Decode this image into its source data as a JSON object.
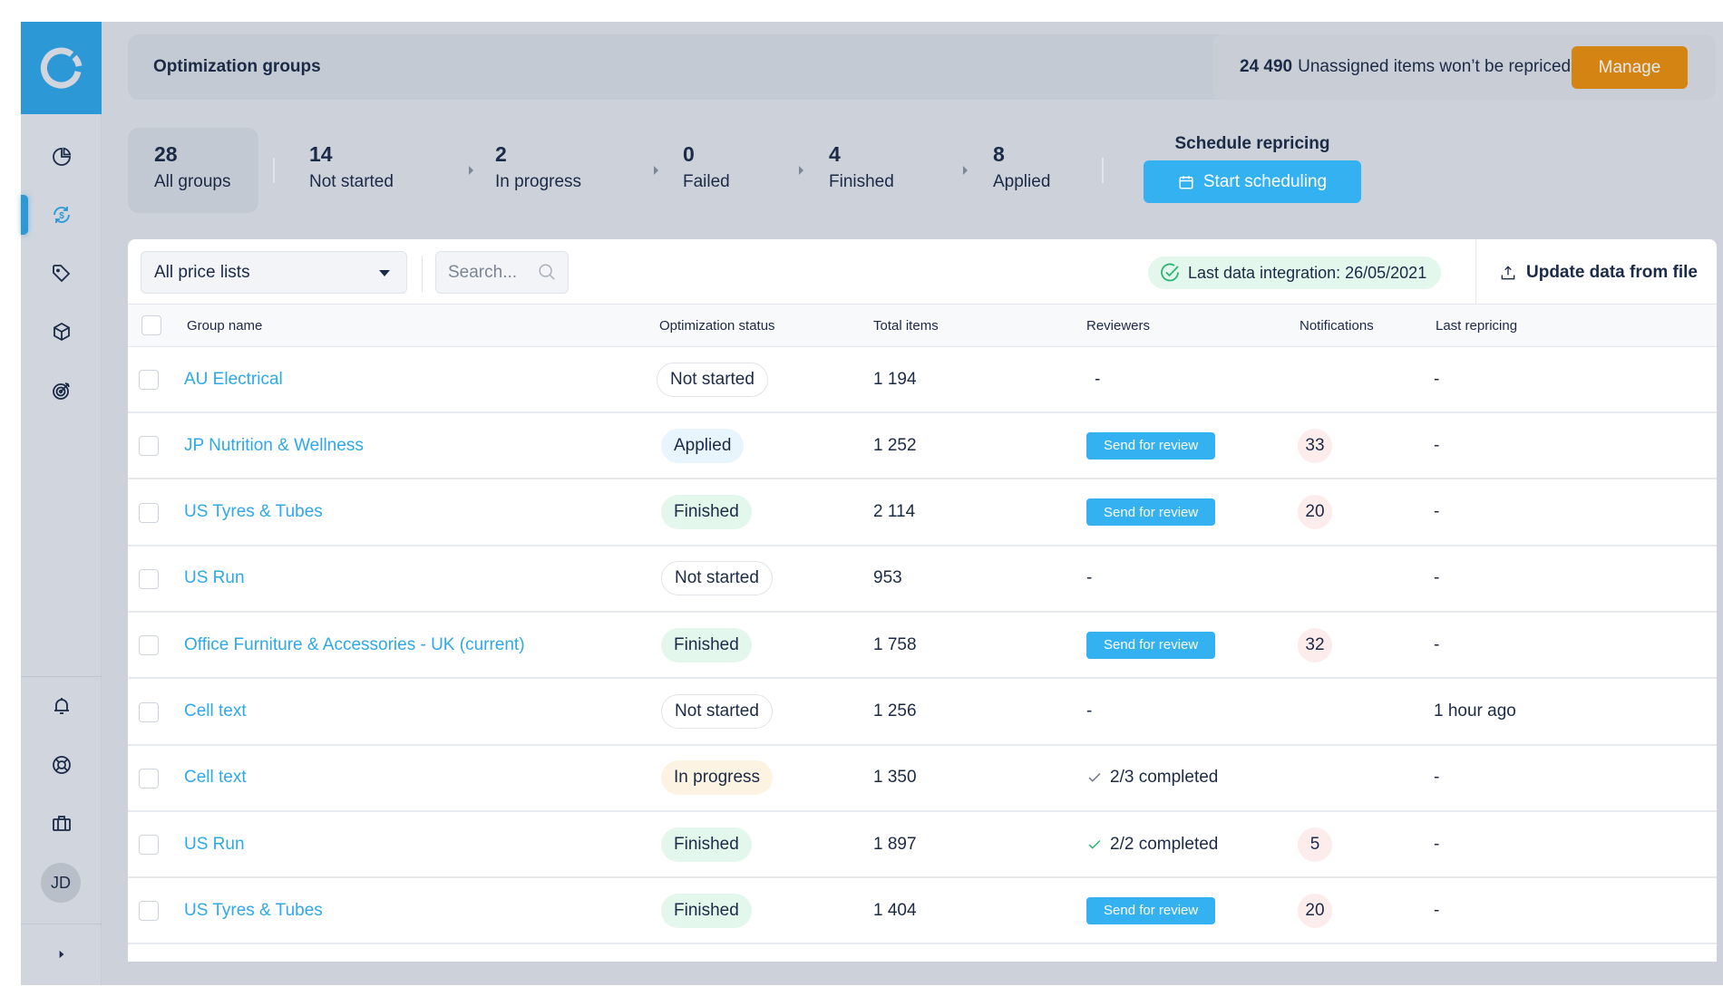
{
  "header": {
    "title": "Optimization groups",
    "unassigned_count": "24 490",
    "unassigned_text": "Unassigned items won’t be repriced",
    "manage_label": "Manage"
  },
  "sidebar": {
    "logo": "logo-icon",
    "items": [
      {
        "name": "dashboard",
        "icon": "pie-chart-icon",
        "active": false
      },
      {
        "name": "repricing",
        "icon": "dollar-cycle-icon",
        "active": true
      },
      {
        "name": "prices",
        "icon": "tag-icon",
        "active": false
      },
      {
        "name": "products",
        "icon": "box-icon",
        "active": false
      },
      {
        "name": "goals",
        "icon": "target-icon",
        "active": false
      }
    ],
    "bottom_items": [
      {
        "name": "notifications",
        "icon": "bell-icon"
      },
      {
        "name": "support",
        "icon": "lifebuoy-icon"
      },
      {
        "name": "integrations",
        "icon": "briefcase-icon"
      }
    ],
    "avatar_initials": "JD",
    "expand_icon": "caret-right-icon"
  },
  "stats": [
    {
      "count": "28",
      "label": "All groups",
      "active": true
    },
    {
      "count": "14",
      "label": "Not started"
    },
    {
      "count": "2",
      "label": "In progress"
    },
    {
      "count": "0",
      "label": "Failed"
    },
    {
      "count": "4",
      "label": "Finished"
    },
    {
      "count": "8",
      "label": "Applied"
    }
  ],
  "schedule": {
    "title": "Schedule repricing",
    "button_label": "Start scheduling"
  },
  "toolbar": {
    "price_list_selected": "All price lists",
    "search_placeholder": "Search...",
    "integration_text": "Last data integration: 26/05/2021",
    "update_label": "Update data from file"
  },
  "table": {
    "columns": [
      "Group name",
      "Optimization status",
      "Total items",
      "Reviewers",
      "Notifications",
      "Last repricing"
    ],
    "rows": [
      {
        "name": "AU Electrical",
        "status": "Not started",
        "status_key": "not-started",
        "total": "1 194",
        "reviewers": "-",
        "reviewers_type": "text",
        "notifications": "",
        "last": "-"
      },
      {
        "name": "JP Nutrition & Wellness",
        "status": "Applied",
        "status_key": "applied",
        "total": "1 252",
        "reviewers": "Send for review",
        "reviewers_type": "button",
        "notifications": "33",
        "last": "-"
      },
      {
        "name": "US Tyres & Tubes",
        "status": "Finished",
        "status_key": "finished",
        "total": "2 114",
        "reviewers": "Send for review",
        "reviewers_type": "button",
        "notifications": "20",
        "last": "-"
      },
      {
        "name": "US Run",
        "status": "Not started",
        "status_key": "not-started",
        "total": "953",
        "reviewers": "-",
        "reviewers_type": "text",
        "notifications": "",
        "last": "-"
      },
      {
        "name": "Office Furniture & Accessories - UK (current)",
        "status": "Finished",
        "status_key": "finished",
        "total": "1 758",
        "reviewers": "Send for review",
        "reviewers_type": "button",
        "notifications": "32",
        "last": "-"
      },
      {
        "name": "Cell text",
        "status": "Not started",
        "status_key": "not-started",
        "total": "1 256",
        "reviewers": "-",
        "reviewers_type": "text",
        "notifications": "",
        "last": "1 hour ago"
      },
      {
        "name": "Cell text",
        "status": "In progress",
        "status_key": "in-progress",
        "total": "1 350",
        "reviewers": "2/3 completed",
        "reviewers_type": "check-gray",
        "notifications": "",
        "last": "-"
      },
      {
        "name": "US Run",
        "status": "Finished",
        "status_key": "finished",
        "total": "1 897",
        "reviewers": "2/2 completed",
        "reviewers_type": "check-green",
        "notifications": "5",
        "last": "-"
      },
      {
        "name": "US Tyres & Tubes",
        "status": "Finished",
        "status_key": "finished",
        "total": "1 404",
        "reviewers": "Send for review",
        "reviewers_type": "button",
        "notifications": "20",
        "last": "-"
      }
    ]
  },
  "colors": {
    "accent": "#2d98d6",
    "button_blue": "#33b1f0",
    "manage_orange": "#d48413",
    "link": "#2ea8e6",
    "success_green": "#2bb673"
  }
}
